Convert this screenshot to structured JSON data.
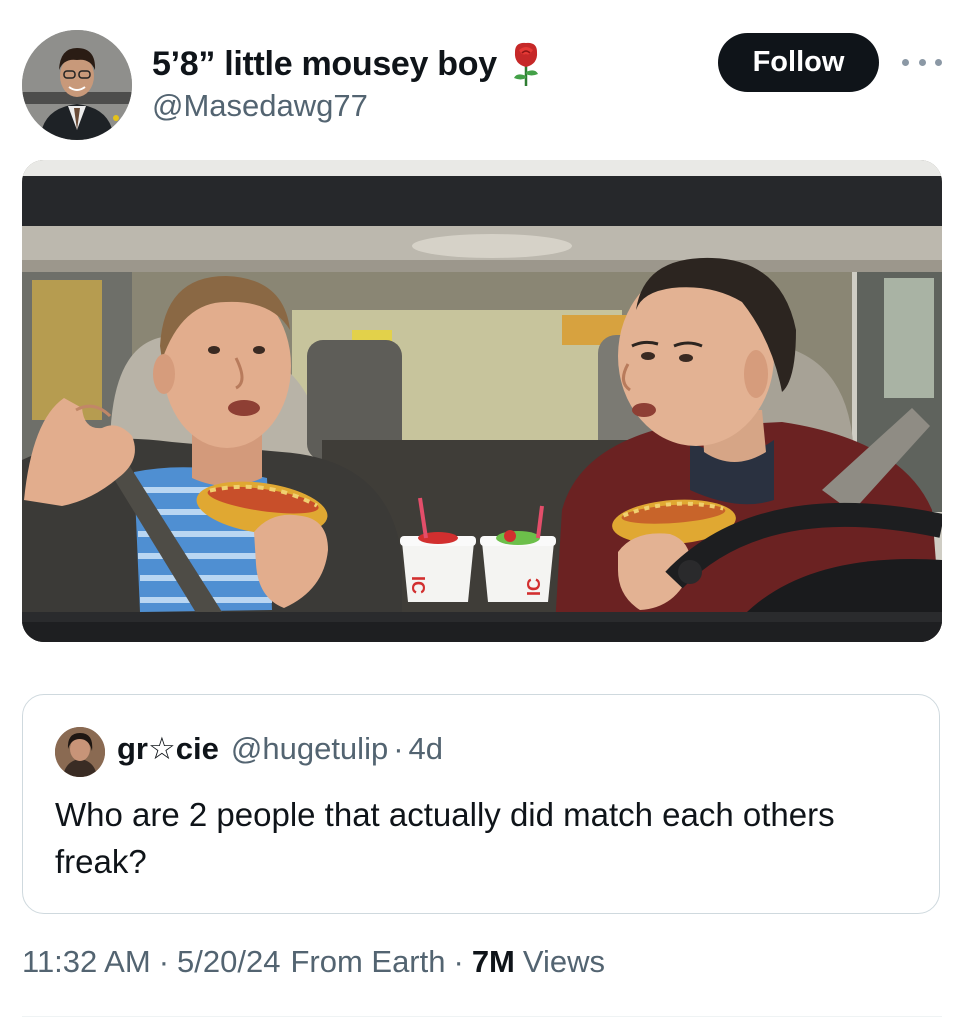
{
  "author": {
    "display_name": "5’8” little mousey boy",
    "badge_icon": "rose-icon",
    "handle": "@Masedawg77",
    "avatar_icon": "profile-photo"
  },
  "actions": {
    "follow_label": "Follow",
    "more_icon": "more-options-icon"
  },
  "media": {
    "type": "image",
    "cup_brand_mark": "IC"
  },
  "quoted_tweet": {
    "display_name": "gr☆cie",
    "handle": "@hugetulip",
    "separator": "·",
    "time": "4d",
    "text": "Who are 2 people that actually did match each others freak?"
  },
  "meta": {
    "time": "11:32 AM",
    "date": "5/20/24",
    "source": "From Earth",
    "views_count": "7M",
    "views_label": "Views",
    "separator": "·"
  }
}
